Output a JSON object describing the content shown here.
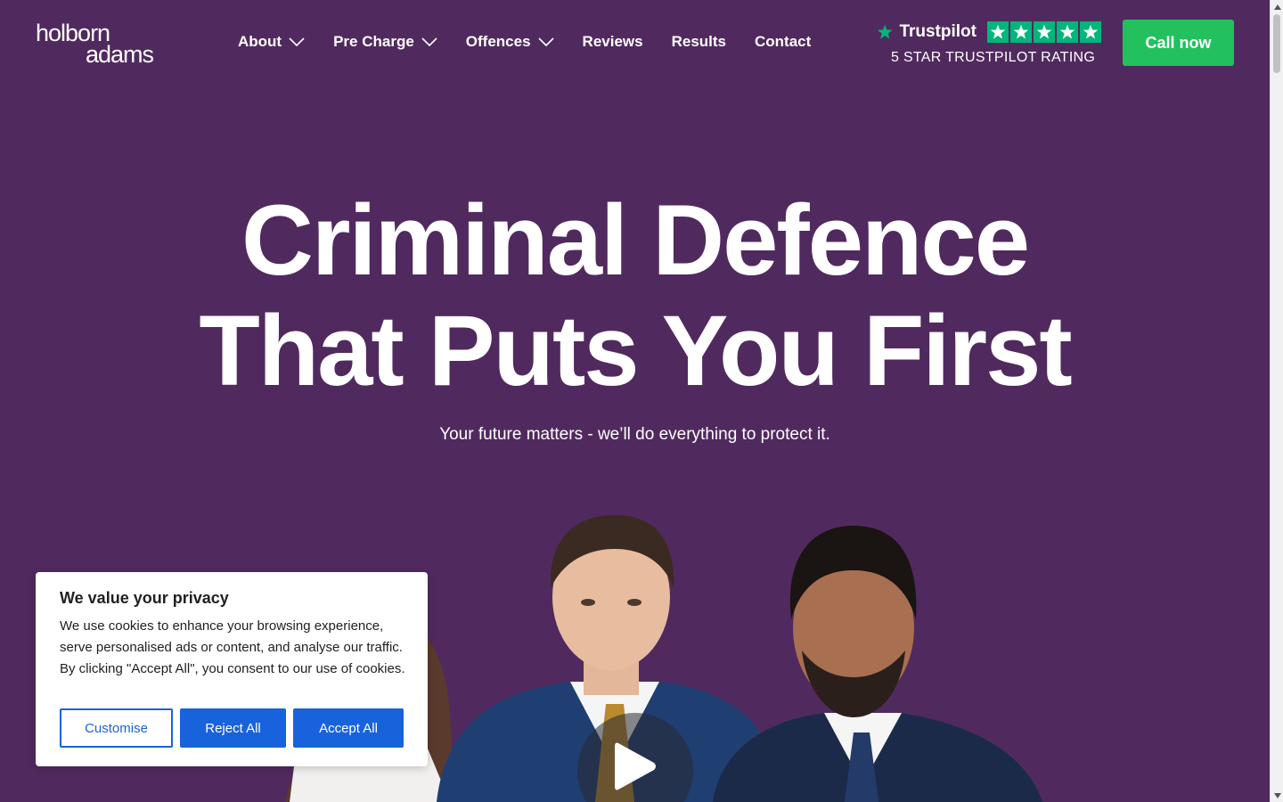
{
  "logo": {
    "line1": "holborn",
    "line2": "adams"
  },
  "nav": {
    "items": [
      {
        "label": "About",
        "has_dropdown": true
      },
      {
        "label": "Pre Charge",
        "has_dropdown": true
      },
      {
        "label": "Offences",
        "has_dropdown": true
      },
      {
        "label": "Reviews",
        "has_dropdown": false
      },
      {
        "label": "Results",
        "has_dropdown": false
      },
      {
        "label": "Contact",
        "has_dropdown": false
      }
    ]
  },
  "trustpilot": {
    "brand": "Trustpilot",
    "rating_stars": 5,
    "caption": "5 STAR TRUSTPILOT RATING",
    "color": "#00b67a"
  },
  "header": {
    "cta_label": "Call now",
    "cta_color": "#22c15e"
  },
  "hero": {
    "title_line1": "Criminal Defence",
    "title_line2": "That Puts You First",
    "subtitle": "Your future matters - we’ll do everything to protect it."
  },
  "video": {
    "icon": "play-icon"
  },
  "cookie": {
    "title": "We value your privacy",
    "text": "We use cookies to enhance your browsing experience, serve personalised ads or content, and analyse our traffic. By clicking \"Accept All\", you consent to our use of cookies.",
    "customise_label": "Customise",
    "reject_label": "Reject All",
    "accept_label": "Accept All",
    "accent_color": "#1863dc"
  },
  "theme": {
    "background": "#502a5e"
  }
}
